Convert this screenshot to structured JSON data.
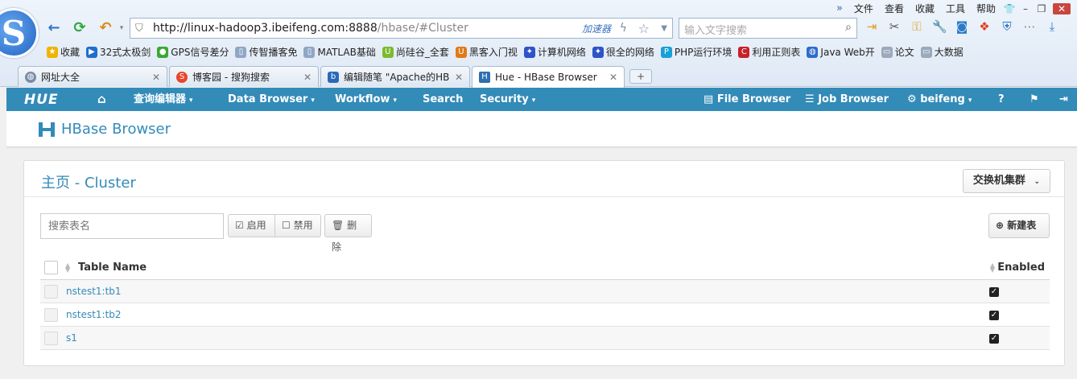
{
  "browser": {
    "menu": [
      "文件",
      "查看",
      "收藏",
      "工具",
      "帮助"
    ],
    "menu_chevrons": "»",
    "url_host": "http://linux-hadoop3.ibeifeng.com:8888",
    "url_path": "/hbase/#Cluster",
    "accelerator_label": "加速器",
    "search_placeholder": "输入文字搜索",
    "bookmarks": [
      {
        "label": "收藏",
        "icon": "star-icon",
        "color": "#f0b400"
      },
      {
        "label": "32式太极剑",
        "icon": "video-icon",
        "color": "#1e6fd0"
      },
      {
        "label": "GPS信号差分",
        "icon": "circle-icon",
        "color": "#3aa832"
      },
      {
        "label": "传智播客免",
        "icon": "page-icon",
        "color": "#8fa7c5"
      },
      {
        "label": "MATLAB基础",
        "icon": "page-icon",
        "color": "#8fa7c5"
      },
      {
        "label": "尚硅谷_全套",
        "icon": "u-icon",
        "color": "#7cba2e"
      },
      {
        "label": "黑客入门视",
        "icon": "u-icon",
        "color": "#e07a18"
      },
      {
        "label": "计算机网络",
        "icon": "paw-icon",
        "color": "#2d54c8"
      },
      {
        "label": "很全的网络",
        "icon": "paw-icon",
        "color": "#2d54c8"
      },
      {
        "label": "PHP运行环境",
        "icon": "p-icon",
        "color": "#18a0d8"
      },
      {
        "label": "利用正则表",
        "icon": "c-icon",
        "color": "#c8202a"
      },
      {
        "label": "Java Web开",
        "icon": "globe-icon",
        "color": "#2f6ccc"
      },
      {
        "label": "论文",
        "icon": "folder-icon",
        "color": "#9aa9bb"
      },
      {
        "label": "大数据",
        "icon": "folder-icon",
        "color": "#9aa9bb"
      }
    ],
    "tabs": [
      {
        "label": "网址大全",
        "icon": "globe-icon",
        "color": "#7a8da5"
      },
      {
        "label": "博客园 - 搜狗搜索",
        "icon": "sogou-icon",
        "color": "#e8452c"
      },
      {
        "label": "编辑随笔 \"Apache的HB",
        "icon": "blog-icon",
        "color": "#2a6ab8"
      },
      {
        "label": "Hue - HBase Browser",
        "icon": "hue-icon",
        "color": "#2d6fb0"
      }
    ],
    "new_tab": "+"
  },
  "hue": {
    "logo": "HUE",
    "nav": {
      "query_editors": "查询编辑器",
      "data_browser": "Data Browser",
      "workflow": "Workflow",
      "search": "Search",
      "security": "Security",
      "file_browser": "File Browser",
      "job_browser": "Job Browser",
      "user": "beifeng"
    },
    "app_title": "HBase Browser",
    "page": {
      "crumb_home": "主页",
      "crumb_sep": " - ",
      "crumb_cluster": "Cluster",
      "switch_cluster": "交换机集群",
      "search_placeholder": "搜索表名",
      "enable": "启用",
      "disable": "禁用",
      "delete": "删除",
      "new_table": "新建表"
    },
    "table": {
      "col_name": "Table Name",
      "col_enabled": "Enabled",
      "rows": [
        {
          "name": "nstest1:tb1",
          "enabled": true
        },
        {
          "name": "nstest1:tb2",
          "enabled": true
        },
        {
          "name": "s1",
          "enabled": true
        }
      ]
    },
    "accent": "#338bb8"
  }
}
